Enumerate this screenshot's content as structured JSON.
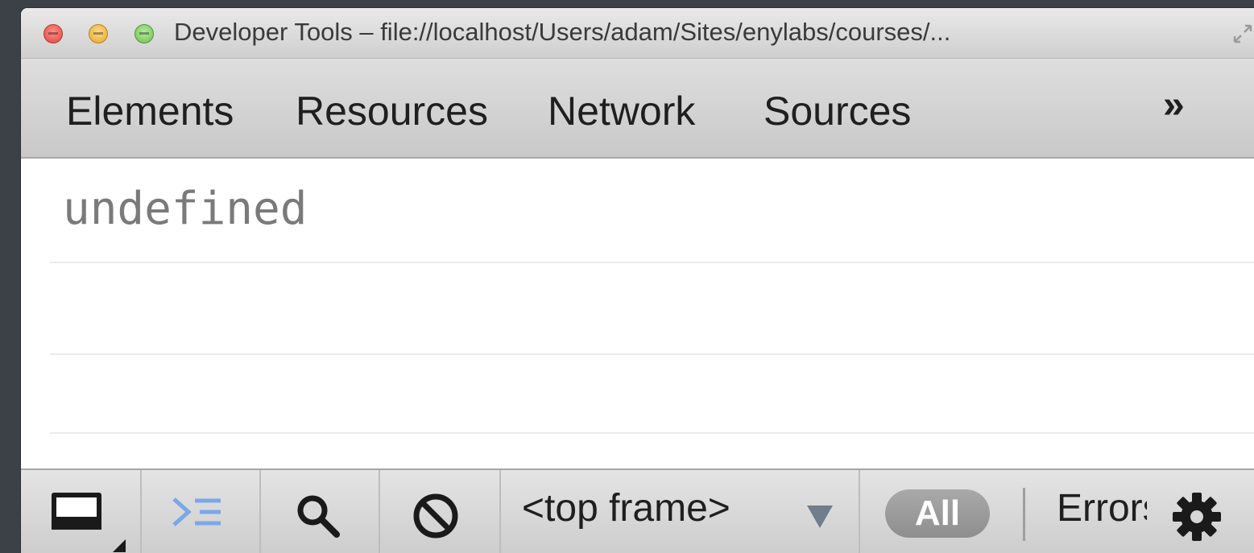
{
  "window": {
    "title": "Developer Tools – file://localhost/Users/adam/Sites/enylabs/courses/..."
  },
  "tabs": [
    {
      "label": "Elements"
    },
    {
      "label": "Resources"
    },
    {
      "label": "Network"
    },
    {
      "label": "Sources"
    }
  ],
  "more_tabs_label": "»",
  "console": {
    "lines": [
      "undefined"
    ]
  },
  "toolbar": {
    "frame_selector": "<top frame>",
    "filter_all": "All",
    "filter_errors": "Errors"
  },
  "icons": {
    "dock": "dock-to-main-icon",
    "console": "show-console-icon",
    "search": "search-icon",
    "clear": "clear-console-icon",
    "settings": "gear-icon"
  },
  "colors": {
    "background": "#3c4047",
    "result_text": "#7a7a7a",
    "console_icon": "#7aa7e8"
  }
}
